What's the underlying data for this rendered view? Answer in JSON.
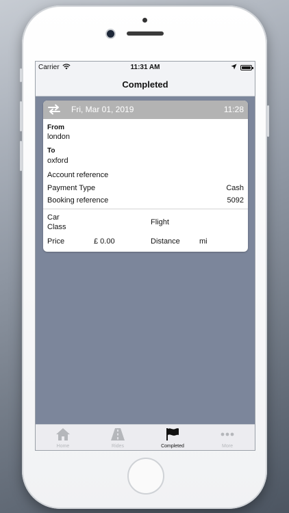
{
  "status_bar": {
    "carrier": "Carrier",
    "time": "11:31 AM"
  },
  "nav": {
    "title": "Completed"
  },
  "booking": {
    "date": "Fri, Mar 01, 2019",
    "time": "11:28",
    "from_label": "From",
    "from_value": "london",
    "to_label": "To",
    "to_value": "oxford",
    "account_reference_label": "Account reference",
    "account_reference_value": "",
    "payment_type_label": "Payment Type",
    "payment_type_value": "Cash",
    "booking_reference_label": "Booking reference",
    "booking_reference_value": "5092",
    "car_class_label_1": "Car",
    "car_class_label_2": "Class",
    "flight_label": "Flight",
    "price_label": "Price",
    "price_value": "£ 0.00",
    "distance_label": "Distance",
    "distance_value": "mi"
  },
  "tabs": [
    {
      "label": "Home",
      "icon": "home-icon"
    },
    {
      "label": "Rides",
      "icon": "road-icon"
    },
    {
      "label": "Completed",
      "icon": "flag-icon"
    },
    {
      "label": "More",
      "icon": "more-icon"
    }
  ],
  "colors": {
    "screen_background": "#7c869b",
    "card_header": "#b3b3b3",
    "tab_active": "#111111",
    "tab_inactive": "#b5b7bb"
  }
}
